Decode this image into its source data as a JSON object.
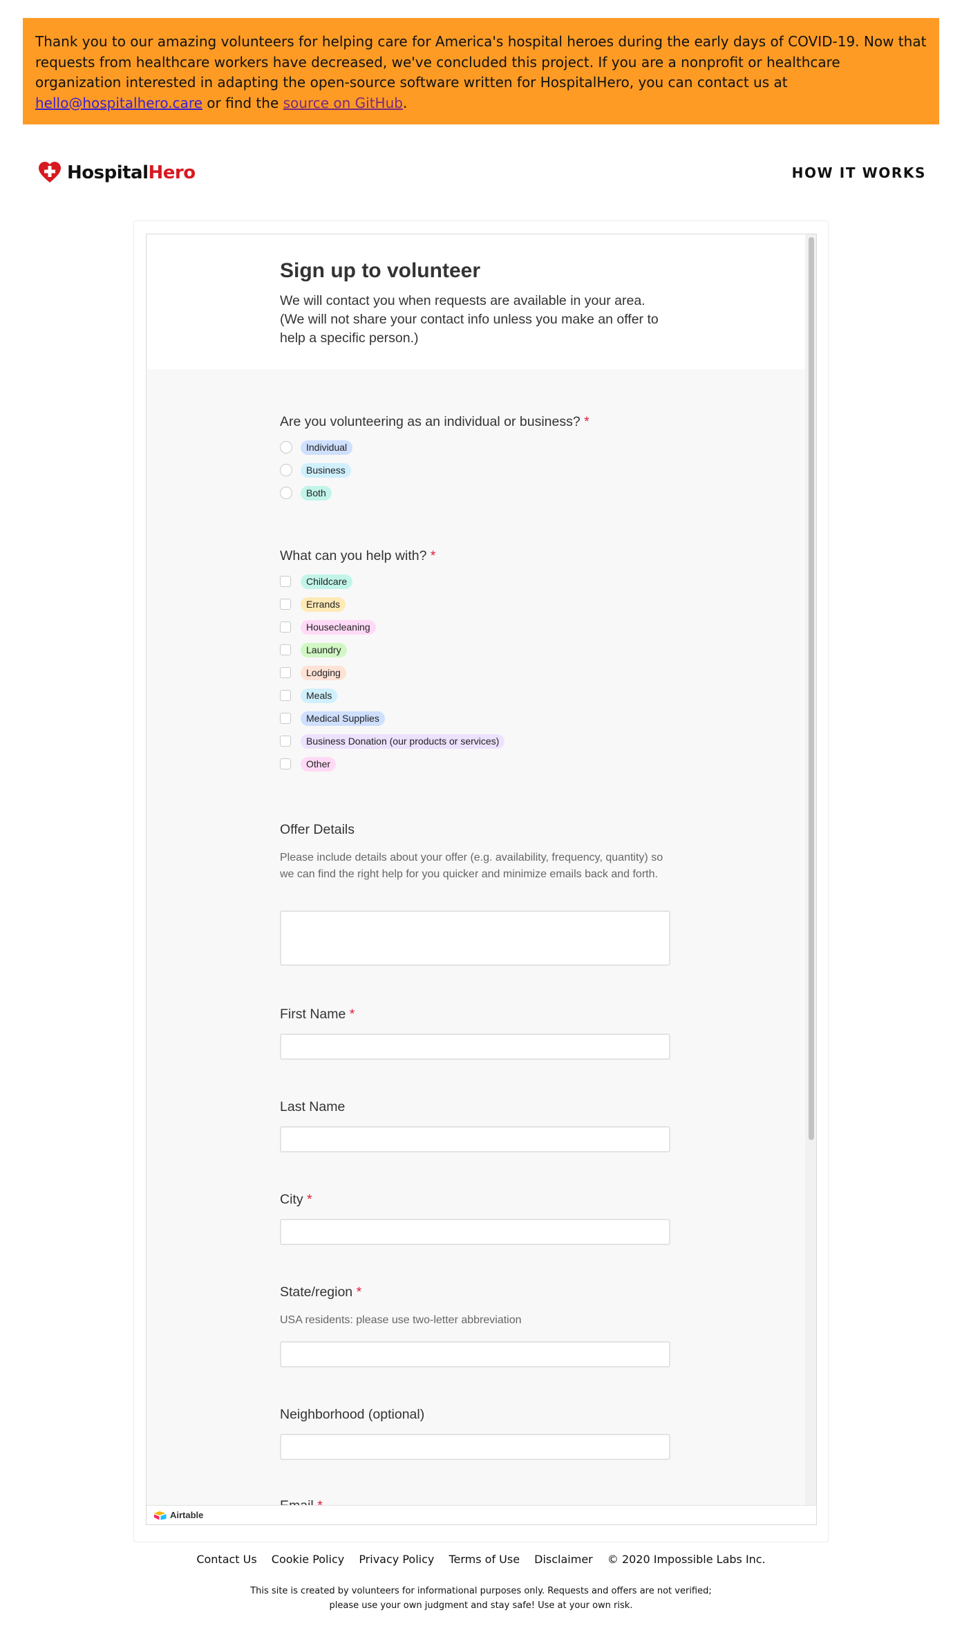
{
  "banner": {
    "text_before": "Thank you to our amazing volunteers for helping care for America's hospital heroes during the early days of COVID-19. Now that requests from healthcare workers have decreased, we've concluded this project. If you are a nonprofit or healthcare organization interested in adapting the open-source software written for HospitalHero, you can contact us at ",
    "email_link": "hello@hospitalhero.care",
    "text_middle": " or find the ",
    "github_link": "source on GitHub",
    "text_after": ".",
    "background_color": "#fe9b25"
  },
  "header": {
    "logo_part1": "Hospital",
    "logo_part2": "Hero",
    "logo_icon": "heart-cross-icon",
    "nav_how_it_works": "HOW IT WORKS",
    "brand_red": "#d71920"
  },
  "form": {
    "title": "Sign up to volunteer",
    "subtitle_line1": "We will contact you when requests are available in your area.",
    "subtitle_line2": "(We will not share your contact info unless you make an offer to help a specific person.)",
    "q1": {
      "label": "Are you volunteering as an individual or business?",
      "required_mark": "*",
      "options": [
        "Individual",
        "Business",
        "Both"
      ]
    },
    "q2": {
      "label": "What can you help with?",
      "required_mark": "*",
      "options": [
        "Childcare",
        "Errands",
        "Housecleaning",
        "Laundry",
        "Lodging",
        "Meals",
        "Medical Supplies",
        "Business Donation (our products or services)",
        "Other"
      ]
    },
    "offer_details": {
      "label": "Offer Details",
      "description": "Please include details about your offer (e.g. availability, frequency, quantity) so we can find the right help for you quicker and minimize emails back and forth.",
      "value": ""
    },
    "first_name": {
      "label": "First Name",
      "required_mark": "*",
      "value": ""
    },
    "last_name": {
      "label": "Last Name",
      "value": ""
    },
    "city": {
      "label": "City",
      "required_mark": "*",
      "value": ""
    },
    "state": {
      "label": "State/region",
      "required_mark": "*",
      "description": "USA residents: please use two-letter abbreviation",
      "value": ""
    },
    "neighborhood": {
      "label": "Neighborhood (optional)",
      "value": ""
    },
    "email": {
      "label": "Email",
      "required_mark": "*"
    },
    "powered_by": "Airtable"
  },
  "footer": {
    "links": [
      "Contact Us",
      "Cookie Policy",
      "Privacy Policy",
      "Terms of Use",
      "Disclaimer"
    ],
    "copyright": "© 2020 Impossible Labs Inc.",
    "note_line1": "This site is created by volunteers for informational purposes only. Requests and offers are not verified;",
    "note_line2": "please use your own judgment and stay safe! Use at your own risk."
  }
}
